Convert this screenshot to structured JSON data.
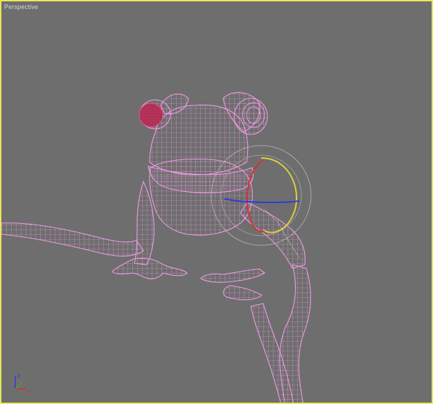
{
  "viewport": {
    "label": "Perspective",
    "border_color": "#e8e85a",
    "background_color": "#6e6e6e"
  },
  "model": {
    "name_icon": "frog-wireframe-icon",
    "wire_color": "#f29be6",
    "eye_color": "#c23a5e"
  },
  "gizmo": {
    "icon": "rotate-gizmo-icon",
    "x_color": "#2d3bd6",
    "y_color": "#d83030",
    "z_color": "#e0d23a"
  },
  "axis_tripod": {
    "icon": "axis-tripod-icon",
    "x_label": "x",
    "y_label": "y",
    "z_label": "z"
  }
}
